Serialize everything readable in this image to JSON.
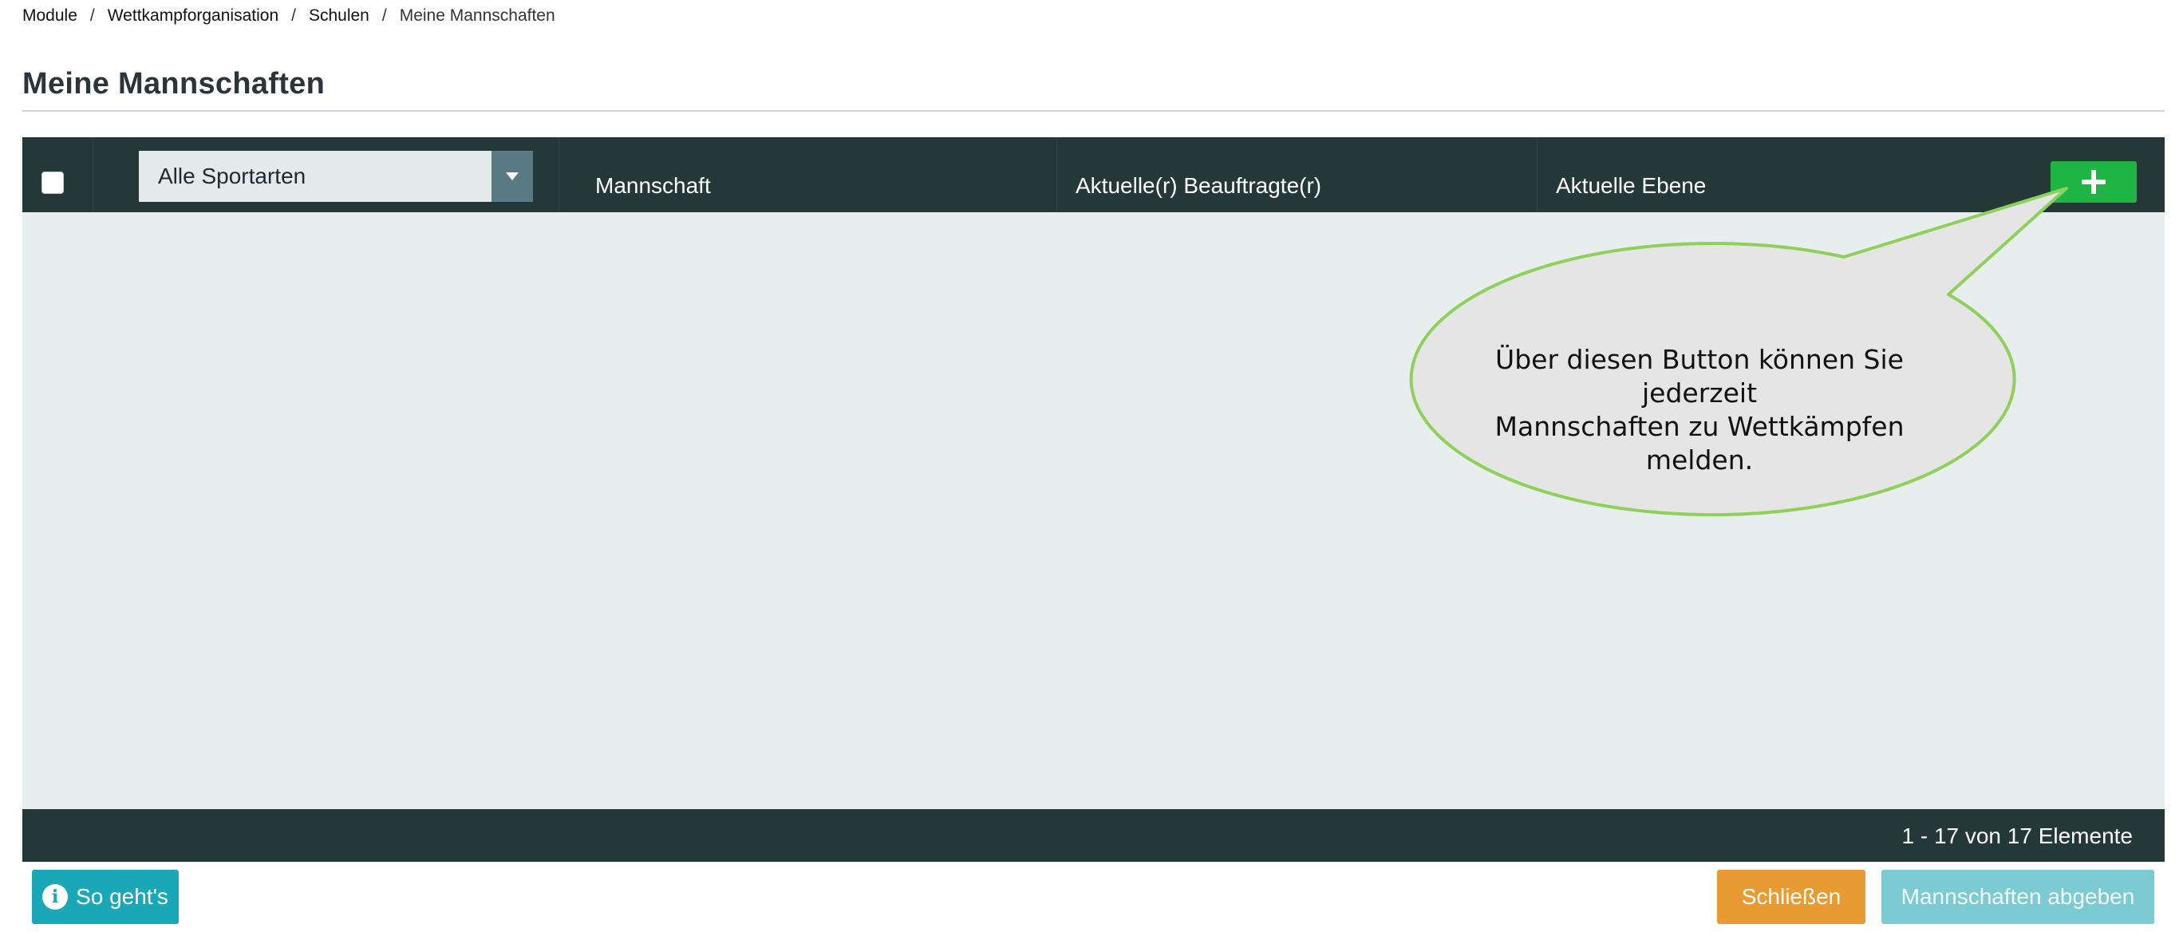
{
  "breadcrumb": {
    "items": [
      "Module",
      "Wettkampforganisation",
      "Schulen",
      "Meine Mannschaften"
    ],
    "separator": "/"
  },
  "page": {
    "title": "Meine Mannschaften"
  },
  "grid": {
    "filter": {
      "selected": "Alle Sportarten"
    },
    "columns": [
      "Mannschaft",
      "Aktuelle(r) Beauftragte(r)",
      "Aktuelle Ebene"
    ],
    "add_button_icon": "plus-icon",
    "pager": {
      "info": "1 - 17 von 17 Elemente"
    }
  },
  "callout": {
    "line1": "Über diesen Button können Sie jederzeit",
    "line2": "Mannschaften zu Wettkämpfen melden."
  },
  "footer": {
    "help_label": "So geht's",
    "help_icon": "info-icon",
    "close_label": "Schließen",
    "submit_label": "Mannschaften abgeben"
  },
  "colors": {
    "header_bg": "#243838",
    "add_button": "#1fb544",
    "help_button": "#1aa8b8",
    "close_button": "#e89a33",
    "submit_button": "#7ccad2",
    "callout_border": "#8fd05a"
  }
}
